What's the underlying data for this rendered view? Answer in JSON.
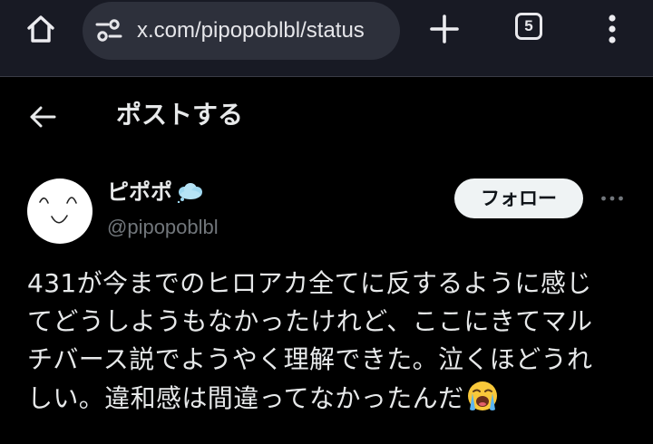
{
  "browser": {
    "url": "x.com/pipopoblbl/status",
    "tab_count": "5",
    "icons": {
      "home": "home-icon",
      "site_settings": "tune-icon",
      "new_tab": "plus-icon",
      "menu": "vertical-dots-icon"
    }
  },
  "header": {
    "title": "ポストする",
    "back_icon": "arrow-left-icon"
  },
  "author": {
    "display_name": "ピポポ",
    "badge_icon": "thought-cloud-emoji",
    "username": "@pipopoblbl",
    "follow_label": "フォロー",
    "more_icon": "horizontal-dots-icon"
  },
  "post": {
    "lines": [
      "431が今までのヒロアカ全てに反するように感じ",
      "てどうしようもなかったけれど、ここにきてマル",
      "チバース説でようやく理解できた。泣くほどうれ",
      "しい。違和感は間違ってなかったんだ"
    ],
    "trailing_emoji": "loudly-crying-face-emoji"
  },
  "colors": {
    "browser_bar": "#181a24",
    "url_pill": "#2d303b",
    "background": "#000000",
    "text_primary": "#e7e9ea",
    "text_secondary": "#71767b",
    "follow_bg": "#eff3f4"
  }
}
